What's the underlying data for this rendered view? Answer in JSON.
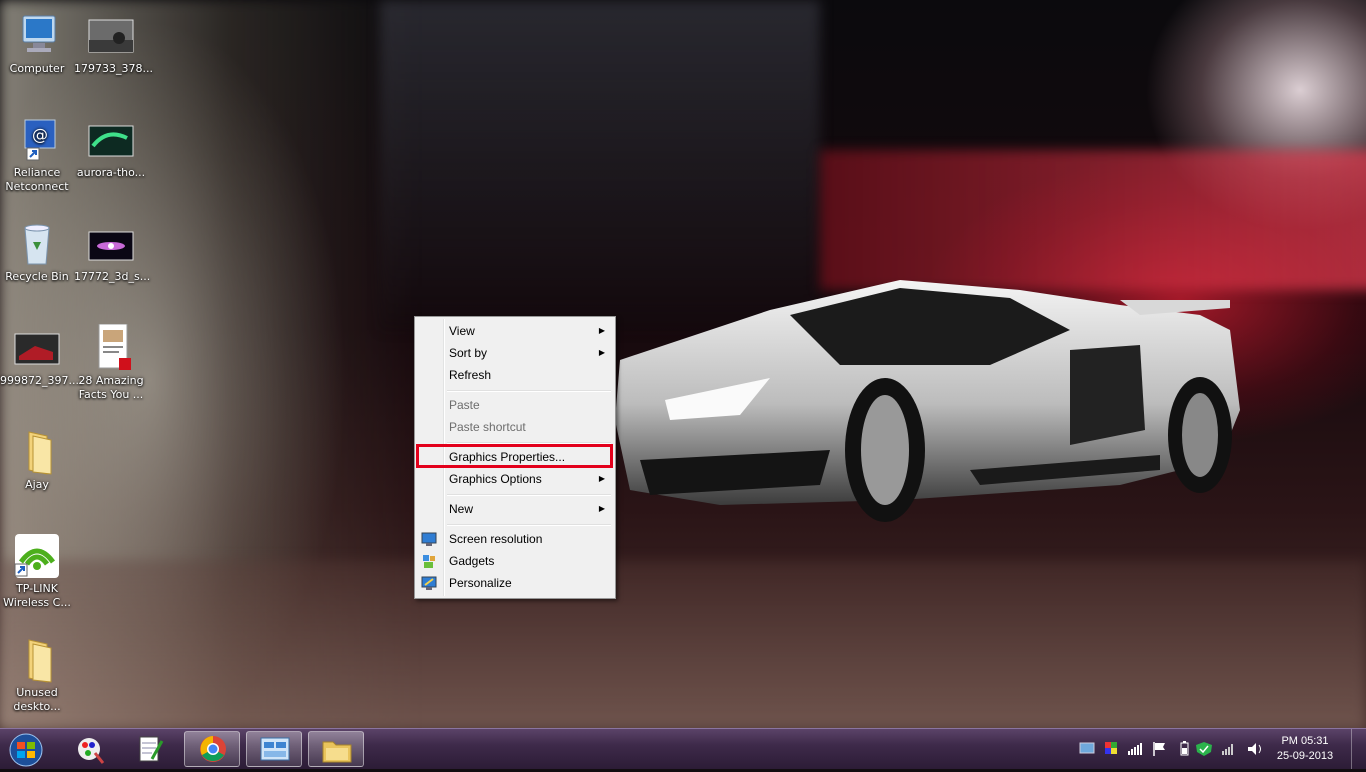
{
  "desktop": {
    "icons": [
      {
        "label": "Computer"
      },
      {
        "label": "179733_378..."
      },
      {
        "label": "Reliance\nNetconnect"
      },
      {
        "label": "aurora-tho..."
      },
      {
        "label": "Recycle Bin"
      },
      {
        "label": "17772_3d_s..."
      },
      {
        "label": "999872_397..."
      },
      {
        "label": "28 Amazing\nFacts You ..."
      },
      {
        "label": "Ajay"
      },
      {
        "label": "TP-LINK\nWireless C..."
      },
      {
        "label": "Unused\ndeskto..."
      }
    ]
  },
  "context_menu": {
    "items": [
      {
        "label": "View"
      },
      {
        "label": "Sort by"
      },
      {
        "label": "Refresh"
      },
      {
        "label": "Paste"
      },
      {
        "label": "Paste shortcut"
      },
      {
        "label": "Graphics Properties..."
      },
      {
        "label": "Graphics Options"
      },
      {
        "label": "New"
      },
      {
        "label": "Screen resolution"
      },
      {
        "label": "Gadgets"
      },
      {
        "label": "Personalize"
      }
    ],
    "highlight_color": "#e3001b"
  },
  "taskbar": {
    "start_icon": "windows-start-orb",
    "pinned": [
      "paint-icon",
      "notepad-icon",
      "chrome-icon",
      "control-panel-icon",
      "explorer-icon"
    ],
    "clock": {
      "time": "PM 05:31",
      "date": "25-09-2013"
    },
    "accent": "#3e2a4a"
  }
}
